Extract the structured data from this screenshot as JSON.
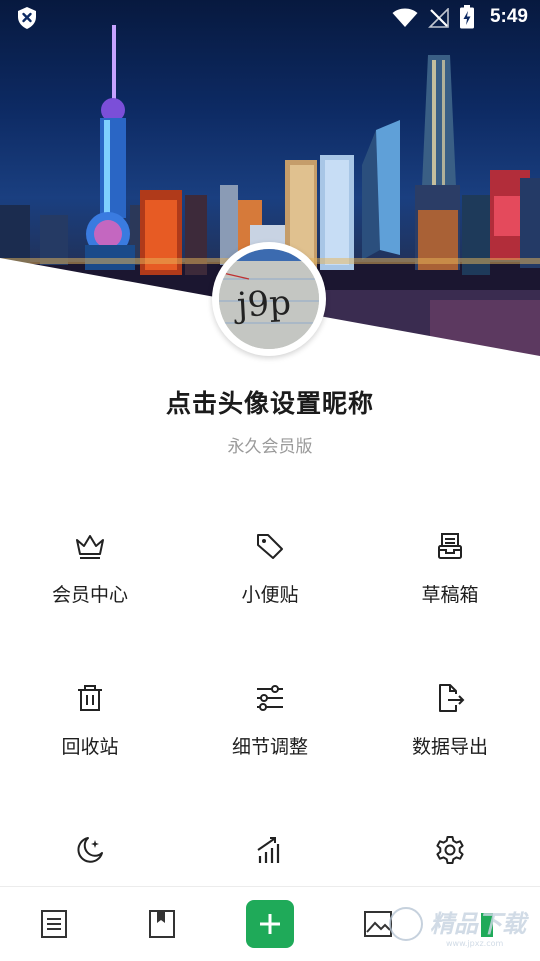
{
  "status_bar": {
    "time": "5:49",
    "icons": [
      "shield-icon",
      "wifi-icon",
      "no-signal-icon",
      "battery-charging-icon"
    ]
  },
  "header": {
    "background": "shanghai-skyline-night-photo"
  },
  "profile": {
    "nickname": "点击头像设置昵称",
    "membership": "永久会员版",
    "avatar_text": "j9p"
  },
  "menu": {
    "items": [
      {
        "label": "会员中心",
        "icon": "crown-icon"
      },
      {
        "label": "小便贴",
        "icon": "tag-icon"
      },
      {
        "label": "草稿箱",
        "icon": "inbox-icon"
      },
      {
        "label": "回收站",
        "icon": "trash-icon"
      },
      {
        "label": "细节调整",
        "icon": "sliders-icon"
      },
      {
        "label": "数据导出",
        "icon": "export-file-icon"
      },
      {
        "label": "",
        "icon": "moon-icon"
      },
      {
        "label": "",
        "icon": "stats-icon"
      },
      {
        "label": "",
        "icon": "settings-icon"
      }
    ]
  },
  "bottom_nav": {
    "items": [
      "notes-icon",
      "bookmark-icon",
      "add-icon",
      "image-icon",
      "profile-icon"
    ]
  },
  "watermark": {
    "text": "精品下载",
    "subtext": "www.jpxz.com"
  },
  "colors": {
    "accent": "#1faa59",
    "text_primary": "#1b1b1b",
    "text_secondary": "#9a9a9a"
  }
}
